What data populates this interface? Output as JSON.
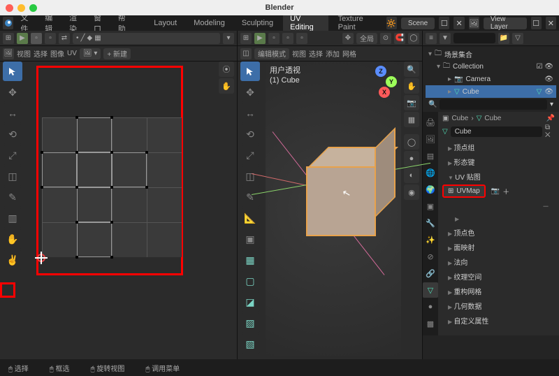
{
  "app": {
    "title": "Blender"
  },
  "topmenu": [
    "文件",
    "编辑",
    "渲染",
    "窗口",
    "帮助"
  ],
  "workspaces": [
    "Layout",
    "Modeling",
    "Sculpting",
    "UV Editing",
    "Texture Paint"
  ],
  "scene_block": {
    "icon": "🔆",
    "name": "Scene",
    "layer": "View Layer"
  },
  "uv": {
    "header_menu": [
      "视图",
      "选择",
      "图像",
      "UV"
    ],
    "new": "+ 新建",
    "mode": "选择"
  },
  "vp": {
    "mode": "编辑模式",
    "menu": [
      "视图",
      "选择",
      "添加",
      "网格"
    ],
    "overlay_title": "用户透视",
    "overlay_sub": "(1) Cube",
    "global": "全局"
  },
  "gizmo": {
    "x": "X",
    "y": "Y",
    "z": "Z"
  },
  "outliner": {
    "title": "场景集合",
    "collection": "Collection",
    "items": [
      {
        "name": "Camera",
        "icon": "📷"
      },
      {
        "name": "Cube",
        "icon": "▽"
      }
    ],
    "search_placeholder": ""
  },
  "props": {
    "bread_obj": "Cube",
    "bread_data": "Cube",
    "data_name": "Cube",
    "sections": [
      "顶点组",
      "形态键"
    ],
    "uv_section": "UV 贴图",
    "uvmap_name": "UVMap",
    "lower_sections": [
      "顶点色",
      "面映射",
      "法向",
      "纹理空间",
      "重构网格",
      "几何数据",
      "自定义属性"
    ]
  },
  "status": {
    "select": "选择",
    "box": "框选",
    "rotate": "旋转视图",
    "menu": "调用菜单"
  }
}
